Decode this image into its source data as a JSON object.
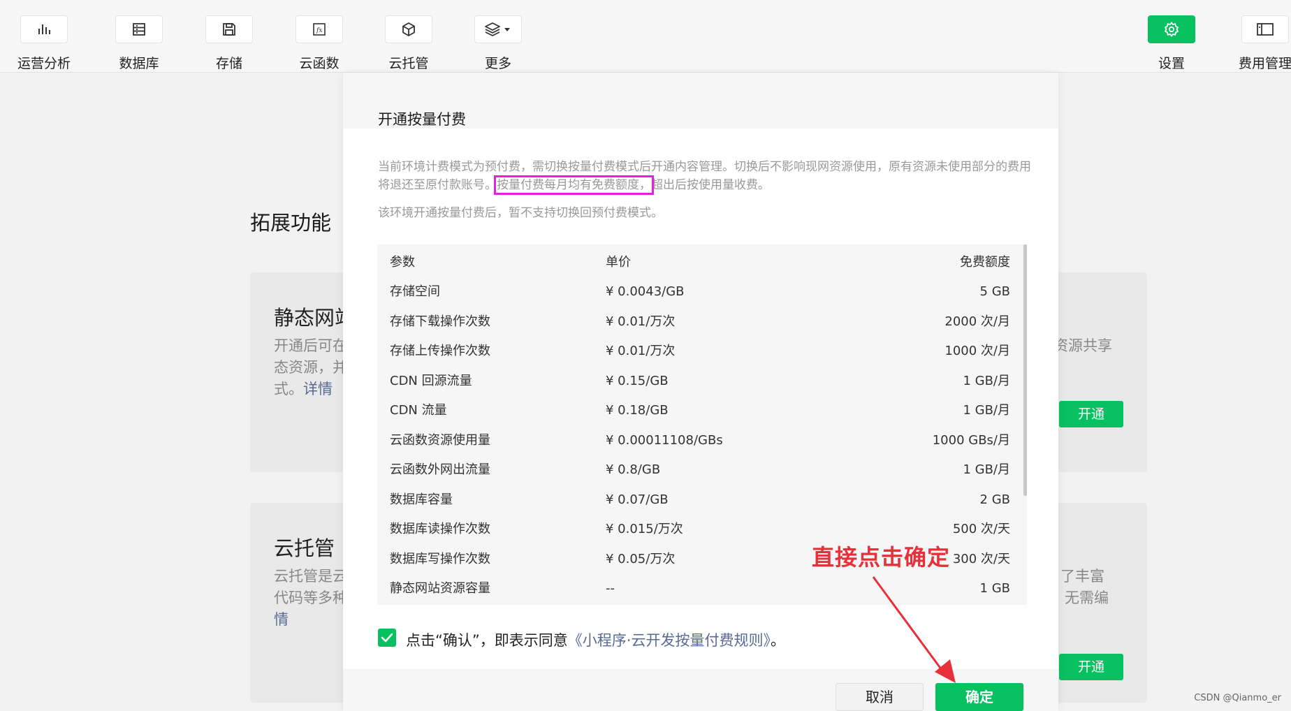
{
  "toolbar": {
    "items": [
      {
        "label": "运营分析",
        "icon": "bar-chart-icon"
      },
      {
        "label": "数据库",
        "icon": "database-icon"
      },
      {
        "label": "存储",
        "icon": "floppy-icon"
      },
      {
        "label": "云函数",
        "icon": "function-icon"
      },
      {
        "label": "云托管",
        "icon": "cube-icon"
      },
      {
        "label": "更多",
        "icon": "layers-icon"
      }
    ],
    "settings_label": "设置",
    "billing_label": "费用管理"
  },
  "background": {
    "section_title": "拓展功能",
    "card1": {
      "title": "静态网站",
      "line1": "开通后可在",
      "line2": "态资源，并",
      "line3_prefix": "式。",
      "link": "详情",
      "right_text": "资源共享",
      "open_button": "开通"
    },
    "card2": {
      "title": "云托管",
      "line1": "云托管是云",
      "line2": "代码等多种",
      "link_tail": "情",
      "right_line1": "了丰富",
      "right_line2": "无需编",
      "open_button": "开通"
    }
  },
  "dialog": {
    "title": "开通按量付费",
    "desc_part1": "当前环境计费模式为预付费，需切换按量付费模式后开通内容管理。切换后不影响现网资源使用，原有资源未使用部分的费用将退还至原付款账号。",
    "desc_highlight": "按量付费每月均有免费额度，",
    "desc_part2": "超出后按使用量收费。",
    "desc_line2": "该环境开通按量付费后，暂不支持切换回预付费模式。",
    "table": {
      "headers": [
        "参数",
        "单价",
        "免费额度"
      ],
      "rows": [
        [
          "存储空间",
          "¥ 0.0043/GB",
          "5 GB"
        ],
        [
          "存储下载操作次数",
          "¥ 0.01/万次",
          "2000 次/月"
        ],
        [
          "存储上传操作次数",
          "¥ 0.01/万次",
          "1000 次/月"
        ],
        [
          "CDN 回源流量",
          "¥ 0.15/GB",
          "1 GB/月"
        ],
        [
          "CDN 流量",
          "¥ 0.18/GB",
          "1 GB/月"
        ],
        [
          "云函数资源使用量",
          "¥ 0.00011108/GBs",
          "1000 GBs/月"
        ],
        [
          "云函数外网出流量",
          "¥ 0.8/GB",
          "1 GB/月"
        ],
        [
          "数据库容量",
          "¥ 0.07/GB",
          "2 GB"
        ],
        [
          "数据库读操作次数",
          "¥ 0.015/万次",
          "500 次/天"
        ],
        [
          "数据库写操作次数",
          "¥ 0.05/万次",
          "300 次/天"
        ],
        [
          "静态网站资源容量",
          "--",
          "1 GB"
        ]
      ]
    },
    "agree_prefix": "点击“确认”，即表示同意",
    "agree_link": "《小程序·云开发按量付费规则》",
    "agree_suffix": "。",
    "cancel_label": "取消",
    "ok_label": "确定"
  },
  "annotation": {
    "text": "直接点击确定"
  },
  "watermark": "CSDN @Qianmo_er",
  "colors": {
    "accent": "#07c160",
    "link": "#576b95",
    "highlight": "#e81ee1",
    "annotation": "#e8303a"
  }
}
